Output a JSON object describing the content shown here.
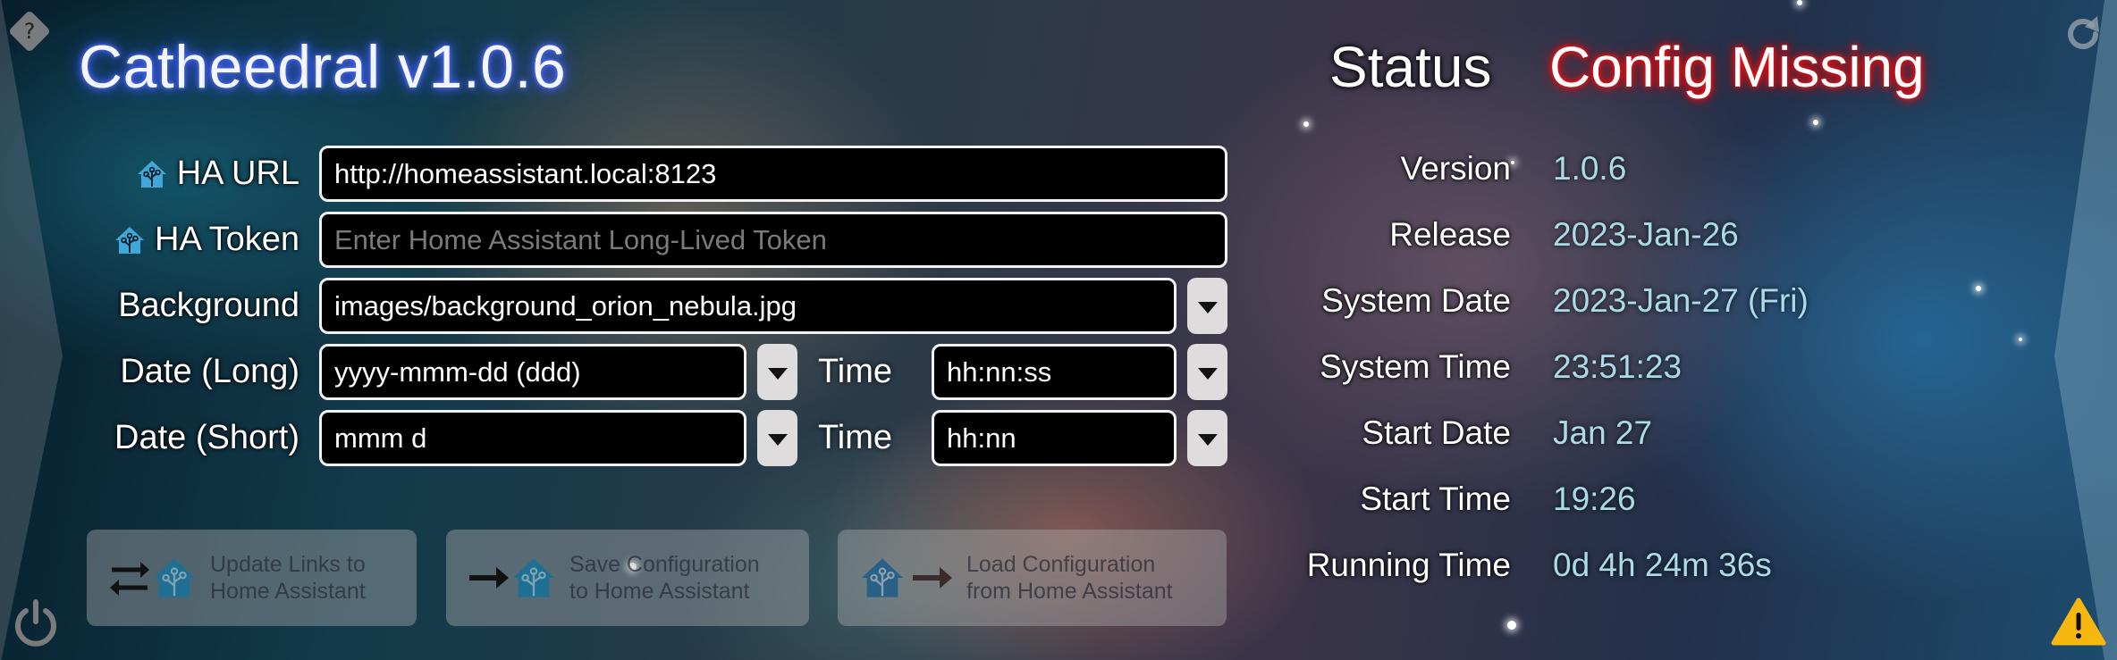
{
  "app": {
    "title": "Catheedral v1.0.6"
  },
  "icons": {
    "help": "help-diamond-icon",
    "refresh": "refresh-icon",
    "power": "power-icon",
    "warning": "warning-triangle-icon",
    "home_assistant": "home-assistant-icon",
    "dropdown": "triangle-down-icon"
  },
  "colors": {
    "title_glow": "#3550ff",
    "status_error": "#e00000",
    "info_value": "#a9dbe8",
    "warning": "#f6b70f",
    "ha_blue": "#41a6d8"
  },
  "form": {
    "ha_url": {
      "label": "HA URL",
      "value": "http://homeassistant.local:8123",
      "placeholder": ""
    },
    "ha_token": {
      "label": "HA Token",
      "value": "",
      "placeholder": "Enter Home Assistant Long-Lived Token"
    },
    "background": {
      "label": "Background",
      "value": "images/background_orion_nebula.jpg"
    },
    "date_long": {
      "label": "Date (Long)",
      "value": "yyyy-mmm-dd (ddd)"
    },
    "time_long": {
      "label": "Time",
      "value": "hh:nn:ss"
    },
    "date_short": {
      "label": "Date (Short)",
      "value": "mmm d"
    },
    "time_short": {
      "label": "Time",
      "value": "hh:nn"
    }
  },
  "actions": [
    {
      "line1": "Update Links to",
      "line2": "Home Assistant"
    },
    {
      "line1": "Save Configuration",
      "line2": "to Home Assistant"
    },
    {
      "line1": "Load Configuration",
      "line2": "from Home Assistant"
    }
  ],
  "status": {
    "label": "Status",
    "value": "Config Missing"
  },
  "info": [
    {
      "label": "Version",
      "value": "1.0.6"
    },
    {
      "label": "Release",
      "value": "2023-Jan-26"
    },
    {
      "label": "System Date",
      "value": "2023-Jan-27 (Fri)"
    },
    {
      "label": "System Time",
      "value": "23:51:23"
    },
    {
      "label": "Start Date",
      "value": "Jan 27"
    },
    {
      "label": "Start Time",
      "value": "19:26"
    },
    {
      "label": "Running Time",
      "value": "0d 4h 24m 36s"
    }
  ]
}
